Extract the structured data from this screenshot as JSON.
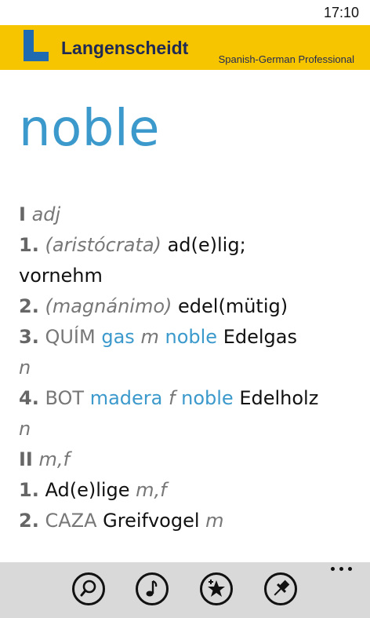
{
  "status": {
    "time": "17:10"
  },
  "header": {
    "logo_letter": "L",
    "brand": "Langenscheidt",
    "edition": "Spanish-German Professional"
  },
  "headword": "noble",
  "entry": {
    "sec1_roman": "I",
    "sec1_gram": "adj",
    "l1_num": "1.",
    "l1_label": "(aristócrata)",
    "l1_trans": "ad(e)lig;",
    "l1b_trans": "vornehm",
    "l2_num": "2.",
    "l2_label": "(magnánimo)",
    "l2_trans": "edel(mütig)",
    "l3_num": "3.",
    "l3_label": "QUÍM",
    "l3_link1": "gas",
    "l3_gram": "m",
    "l3_link2": "noble",
    "l3_trans": "Edelgas",
    "l3b_gram": "n",
    "l4_num": "4.",
    "l4_label": "BOT",
    "l4_link1": "madera",
    "l4_gram": "f",
    "l4_link2": "noble",
    "l4_trans": "Edelholz",
    "l4b_gram": "n",
    "sec2_roman": "II",
    "sec2_gram": "m,f",
    "m1_num": "1.",
    "m1_trans": "Ad(e)lige",
    "m1_gram": "m,f",
    "m2_num": "2.",
    "m2_label": "CAZA",
    "m2_trans": "Greifvogel",
    "m2_gram": "m"
  },
  "appbar": {
    "buttons": [
      {
        "icon": "search-icon"
      },
      {
        "icon": "music-note-icon"
      },
      {
        "icon": "add-favorite-icon"
      },
      {
        "icon": "pin-icon"
      }
    ],
    "more": "more-options-icon"
  },
  "colors": {
    "header": "#f7c400",
    "brand": "#1f2a55",
    "accent": "#3b99cc",
    "appbar": "#d9d9d9"
  }
}
